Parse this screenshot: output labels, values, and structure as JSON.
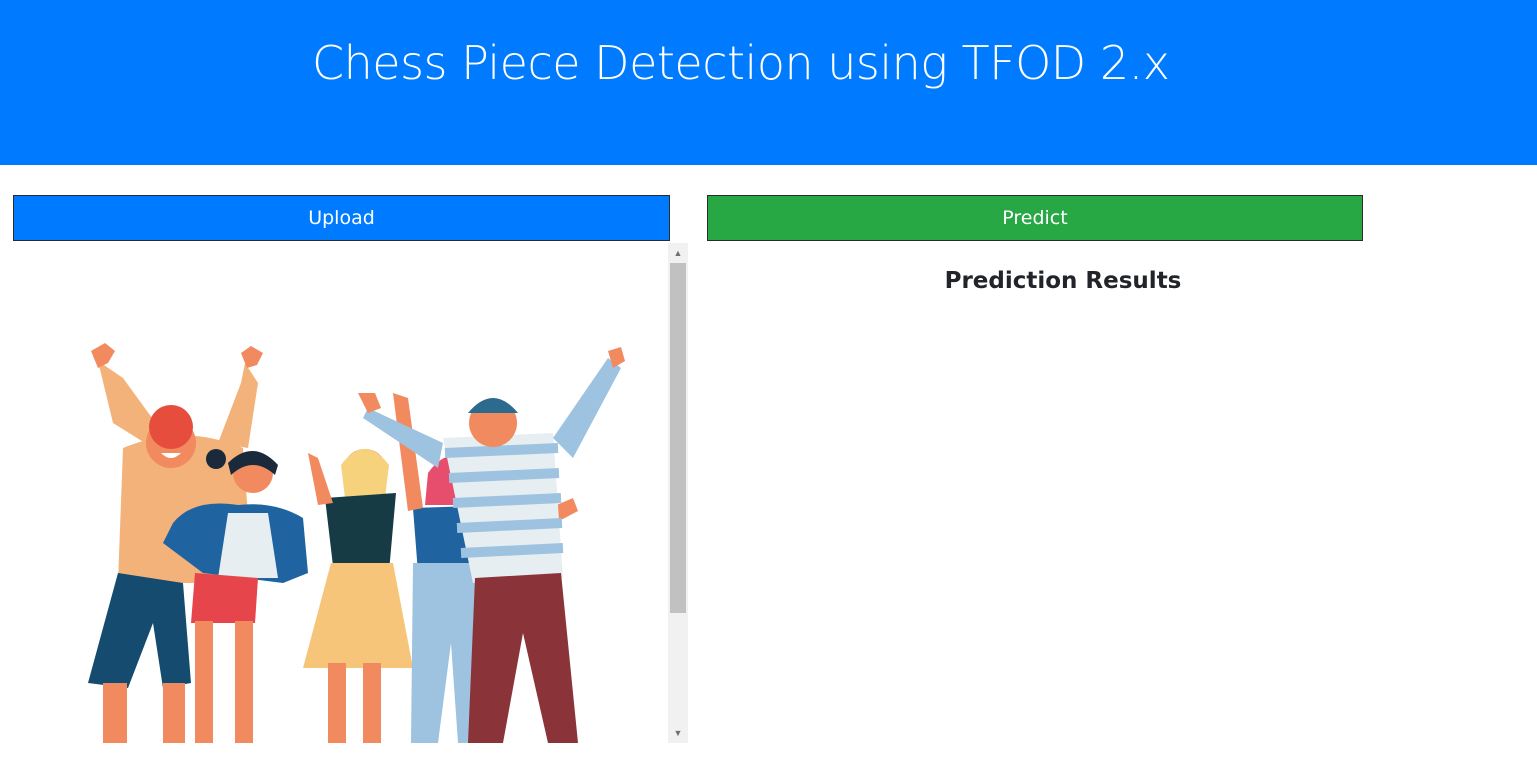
{
  "header": {
    "title": "Chess Piece Detection using TFOD 2.x"
  },
  "buttons": {
    "upload_label": "Upload",
    "predict_label": "Predict"
  },
  "results": {
    "title": "Prediction Results"
  },
  "colors": {
    "primary": "#007bff",
    "success": "#28a745",
    "text": "#212529"
  },
  "image_panel": {
    "content": "illustration-group-of-people"
  }
}
